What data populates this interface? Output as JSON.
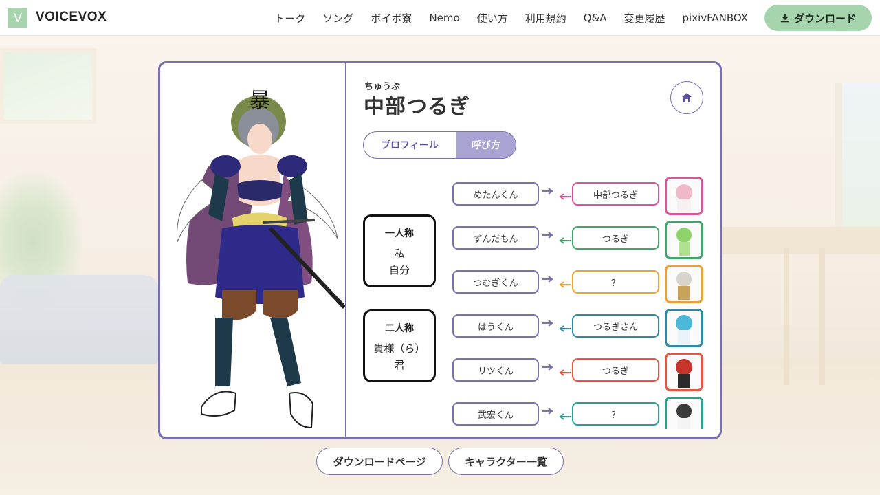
{
  "header": {
    "logo_letter": "V",
    "brand": "VOICEVOX",
    "nav": [
      "トーク",
      "ソング",
      "ボイボ寮",
      "Nemo",
      "使い方",
      "利用規約",
      "Q&A",
      "変更履歴",
      "pixivFANBOX"
    ],
    "download_label": "ダウンロード",
    "download_icon": "download-icon"
  },
  "character": {
    "ruby": "ちゅうぶ",
    "name": "中部つるぎ",
    "home_icon": "home-icon"
  },
  "tabs": {
    "profile": "プロフィール",
    "calling": "呼び方",
    "active": "calling"
  },
  "pronouns": {
    "first": {
      "heading": "一人称",
      "values": [
        "私",
        "自分"
      ]
    },
    "second": {
      "heading": "二人称",
      "values": [
        "貴様（ら）",
        "君"
      ]
    }
  },
  "relations": [
    {
      "called_by_me": "めたんくん",
      "calls_me": "中部つるぎ",
      "color": "#d9559a"
    },
    {
      "called_by_me": "ずんだもん",
      "calls_me": "つるぎ",
      "color": "#3fa66a"
    },
    {
      "called_by_me": "つむぎくん",
      "calls_me": "？",
      "color": "#f0a030"
    },
    {
      "called_by_me": "はうくん",
      "calls_me": "つるぎさん",
      "color": "#2a8aa8"
    },
    {
      "called_by_me": "リツくん",
      "calls_me": "つるぎ",
      "color": "#e8553e"
    },
    {
      "called_by_me": "武宏くん",
      "calls_me": "？",
      "color": "#2aa090"
    }
  ],
  "theme": {
    "accent": "#7a6fb0",
    "green": "#a5d4ad"
  },
  "bottom": {
    "download_page": "ダウンロードページ",
    "character_list": "キャラクター一覧"
  }
}
